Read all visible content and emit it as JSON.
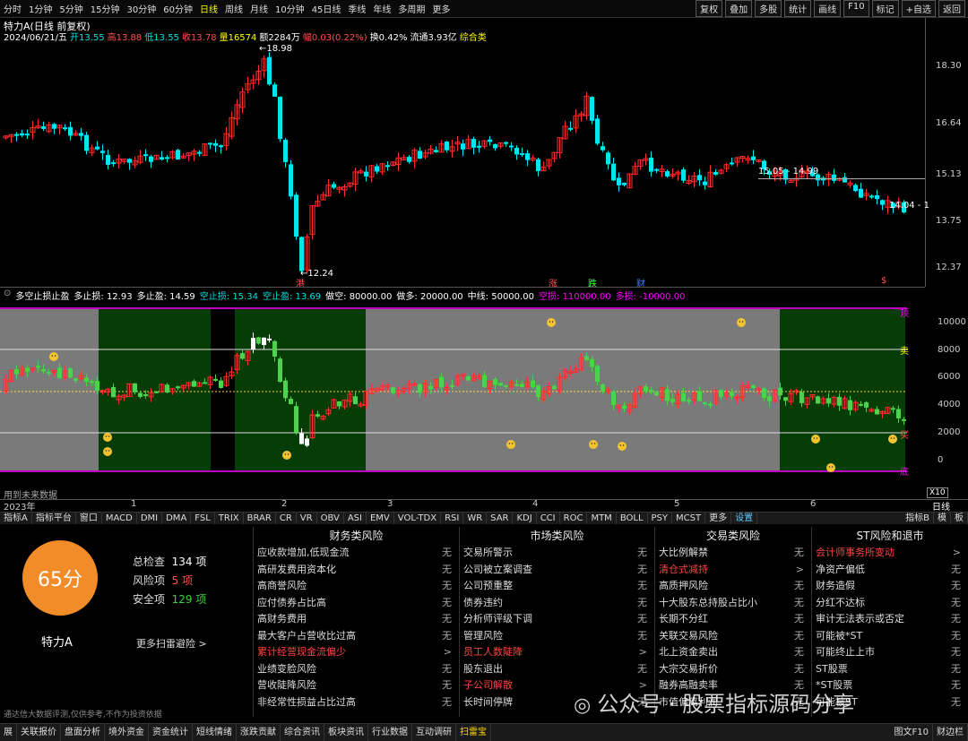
{
  "periods": [
    "分时",
    "1分钟",
    "5分钟",
    "15分钟",
    "30分钟",
    "60分钟",
    "日线",
    "周线",
    "月线",
    "10分钟",
    "45日线",
    "季线",
    "年线",
    "多周期",
    "更多"
  ],
  "active_period": "日线",
  "toolbar": [
    "复权",
    "叠加",
    "多股",
    "统计",
    "画线",
    "F10",
    "标记",
    "+自选",
    "返回"
  ],
  "stock": {
    "title": "特力A",
    "title_suffix": "(日线 前复权)",
    "info": [
      {
        "t": "2024/06/21/五",
        "c": "#ffffff"
      },
      {
        "t": "开13.55",
        "c": "#00e0e0"
      },
      {
        "t": "高13.88",
        "c": "#ff5050"
      },
      {
        "t": "低13.55",
        "c": "#00e0e0"
      },
      {
        "t": "收13.78",
        "c": "#ff5050"
      },
      {
        "t": "量16574",
        "c": "#ffff00"
      },
      {
        "t": "额2284万",
        "c": "#ffffff"
      },
      {
        "t": "幅0.03(0.22%)",
        "c": "#ff5050"
      },
      {
        "t": "换0.42%",
        "c": "#ffffff"
      },
      {
        "t": "流通3.93亿",
        "c": "#ffffff"
      },
      {
        "t": "综合类",
        "c": "#ffff00"
      }
    ]
  },
  "price_axis": [
    "18.30",
    "16.64",
    "15.13",
    "13.75",
    "12.37"
  ],
  "price_marks": {
    "high": "18.98",
    "low": "12.24",
    "r1": "15.05 - 14.99",
    "r2": "14.04 - 1"
  },
  "event_marks": [
    "港",
    "涨",
    "跌",
    "财",
    "$"
  ],
  "indicator": {
    "name": "多空止损止盈",
    "params": [
      {
        "t": "多止损: 12.93",
        "c": "#ffffff"
      },
      {
        "t": "多止盈: 14.59",
        "c": "#ffffff"
      },
      {
        "t": "空止损: 15.34",
        "c": "#00e0e0"
      },
      {
        "t": "空止盈: 13.69",
        "c": "#00e0e0"
      },
      {
        "t": "做空: 80000.00",
        "c": "#ffffff"
      },
      {
        "t": "做多: 20000.00",
        "c": "#ffffff"
      },
      {
        "t": "中线: 50000.00",
        "c": "#ffffff"
      },
      {
        "t": "空损: 110000.00",
        "c": "#ff00ff"
      },
      {
        "t": "多损: -10000.00",
        "c": "#ff00ff"
      }
    ],
    "axis": [
      "10000",
      "8000",
      "6000",
      "4000",
      "2000",
      "0"
    ],
    "tags": [
      "顶",
      "卖",
      "买",
      "底"
    ],
    "future_note": "用到未来数据",
    "scale": "X10"
  },
  "time_axis": [
    "2023年",
    "1",
    "2",
    "3",
    "4",
    "5",
    "6"
  ],
  "timeframe_label": "日线",
  "indicator_tabs": [
    "指标A",
    "指标平台",
    "窗口",
    "MACD",
    "DMI",
    "DMA",
    "FSL",
    "TRIX",
    "BRAR",
    "CR",
    "VR",
    "OBV",
    "ASI",
    "EMV",
    "VOL-TDX",
    "RSI",
    "WR",
    "SAR",
    "KDJ",
    "CCI",
    "ROC",
    "MTM",
    "BOLL",
    "PSY",
    "MCST",
    "更多",
    "设置"
  ],
  "right_tabs": [
    "指标B",
    "模",
    "板"
  ],
  "score": {
    "value": "65分",
    "name": "特力A",
    "total_label": "总检查",
    "total": "134 项",
    "risk_label": "风险项",
    "risk": "5 项",
    "safe_label": "安全项",
    "safe": "129 项",
    "more": "更多扫雷避险 >"
  },
  "risk_columns": [
    {
      "title": "财务类风险",
      "items": [
        {
          "t": "应收款增加,低现金流",
          "s": "无"
        },
        {
          "t": "高研发费用资本化",
          "s": "无"
        },
        {
          "t": "高商誉风险",
          "s": "无"
        },
        {
          "t": "应付债券占比高",
          "s": "无"
        },
        {
          "t": "高财务费用",
          "s": "无"
        },
        {
          "t": "最大客户占营收比过高",
          "s": "无"
        },
        {
          "t": "累计经营现金流偏少",
          "s": ">",
          "hl": true
        },
        {
          "t": "业绩变脸风险",
          "s": "无"
        },
        {
          "t": "营收陡降风险",
          "s": "无"
        },
        {
          "t": "非经常性损益占比过高",
          "s": "无"
        }
      ]
    },
    {
      "title": "市场类风险",
      "items": [
        {
          "t": "交易所警示",
          "s": "无"
        },
        {
          "t": "公司被立案调查",
          "s": "无"
        },
        {
          "t": "公司预重整",
          "s": "无"
        },
        {
          "t": "债券违约",
          "s": "无"
        },
        {
          "t": "分析师评级下调",
          "s": "无"
        },
        {
          "t": "管理风险",
          "s": "无"
        },
        {
          "t": "员工人数陡降",
          "s": ">",
          "hl": true
        },
        {
          "t": "股东退出",
          "s": "无"
        },
        {
          "t": "子公司解散",
          "s": ">",
          "hl": true
        },
        {
          "t": "长时间停牌",
          "s": "无"
        }
      ]
    },
    {
      "title": "交易类风险",
      "items": [
        {
          "t": "大比例解禁",
          "s": "无"
        },
        {
          "t": "清仓式减持",
          "s": ">",
          "hl": true
        },
        {
          "t": "高质押风险",
          "s": "无"
        },
        {
          "t": "十大股东总持股占比小",
          "s": "无"
        },
        {
          "t": "长期不分红",
          "s": "无"
        },
        {
          "t": "关联交易风险",
          "s": "无"
        },
        {
          "t": "北上资金卖出",
          "s": "无"
        },
        {
          "t": "大宗交易折价",
          "s": "无"
        },
        {
          "t": "融券高融卖率",
          "s": "无"
        },
        {
          "t": "市值偏离利润",
          "s": "无"
        }
      ]
    },
    {
      "title": "ST风险和退市",
      "items": [
        {
          "t": "会计师事务所变动",
          "s": ">",
          "hl": true
        },
        {
          "t": "净资产偏低",
          "s": "无"
        },
        {
          "t": "财务造假",
          "s": "无"
        },
        {
          "t": "分红不达标",
          "s": "无"
        },
        {
          "t": "审计无法表示或否定",
          "s": "无"
        },
        {
          "t": "可能被*ST",
          "s": "无"
        },
        {
          "t": "可能终止上市",
          "s": "无"
        },
        {
          "t": "ST股票",
          "s": "无"
        },
        {
          "t": "*ST股票",
          "s": "无"
        },
        {
          "t": "可能被ST",
          "s": "无"
        }
      ]
    }
  ],
  "disclaimer": "通达信大数据评测,仅供参考,不作为投资依据",
  "watermark": "公众号 · 股票指标源码分享",
  "bottom_tabs": [
    "展",
    "关联报价",
    "盘面分析",
    "境外资金",
    "资金统计",
    "短线情绪",
    "涨跌贡献",
    "综合资讯",
    "板块资讯",
    "行业数据",
    "互动调研",
    "扫雷宝"
  ],
  "bottom_right": [
    "图文F10",
    "财边栏"
  ],
  "colors": {
    "up": "#ff3030",
    "down": "#00e5ee",
    "box_green": "#063d06",
    "box_gray": "#7a7a7a",
    "frame": "#c000c0"
  }
}
